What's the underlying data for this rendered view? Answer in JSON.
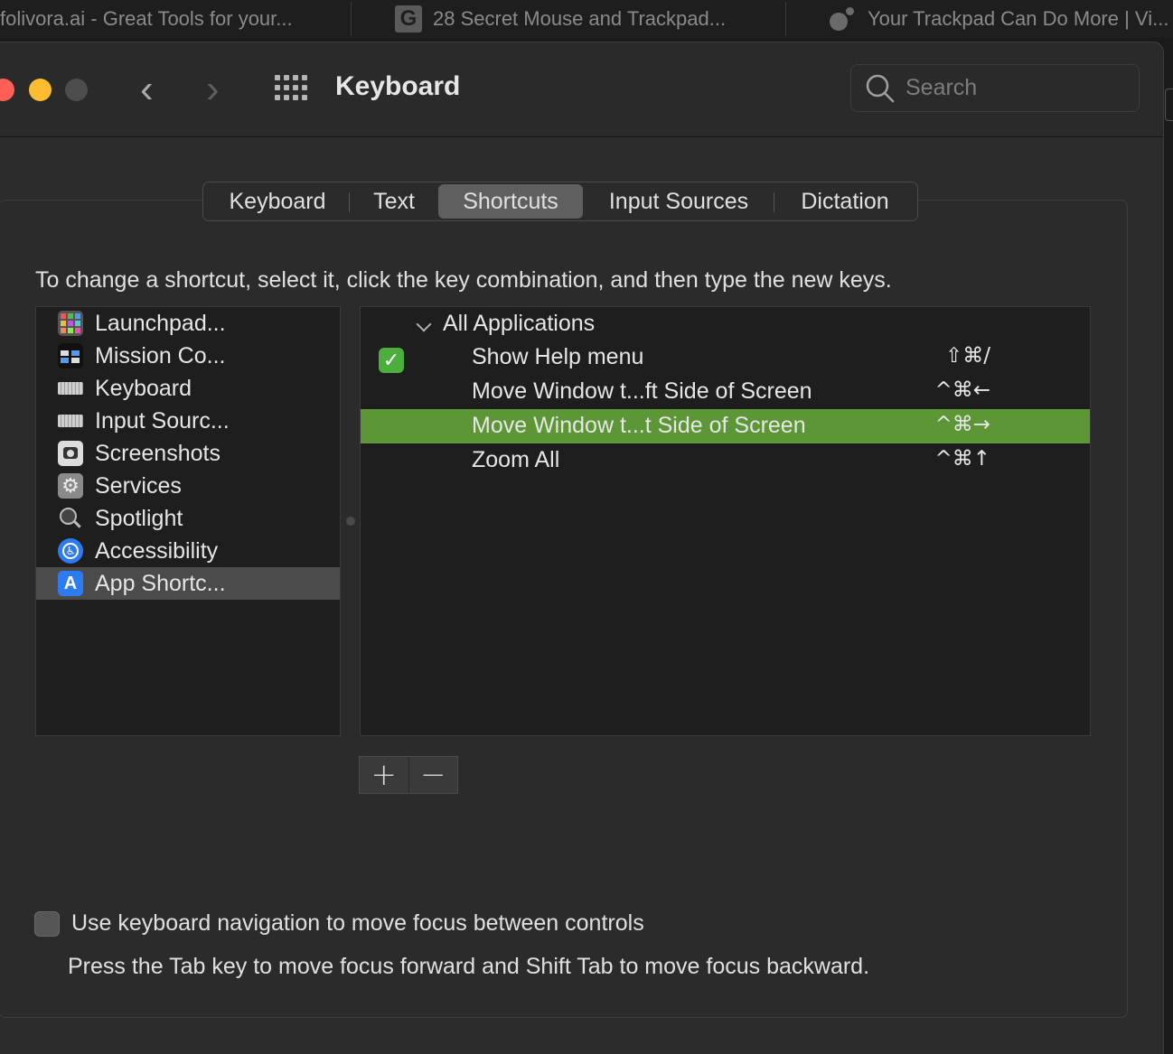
{
  "browser_tabs": [
    {
      "title": "folivora.ai - Great Tools for your..."
    },
    {
      "title": "28 Secret Mouse and Trackpad...",
      "icon": "G"
    },
    {
      "title": "Your Trackpad Can Do More | Vi..."
    }
  ],
  "window": {
    "title": "Keyboard",
    "search_placeholder": "Search",
    "traffic_lights": {
      "close": "#ff5f57",
      "minimize": "#febc2e",
      "zoom": "#4d4d4d"
    }
  },
  "tabs": [
    {
      "label": "Keyboard"
    },
    {
      "label": "Text"
    },
    {
      "label": "Shortcuts",
      "active": true
    },
    {
      "label": "Input Sources"
    },
    {
      "label": "Dictation"
    }
  ],
  "instruction": "To change a shortcut, select it, click the key combination, and then type the new keys.",
  "categories": [
    {
      "label": "Launchpad...",
      "icon": "launchpad-icon"
    },
    {
      "label": "Mission Co...",
      "icon": "mission-control-icon"
    },
    {
      "label": "Keyboard",
      "icon": "keyboard-icon"
    },
    {
      "label": "Input Sourc...",
      "icon": "input-sources-icon"
    },
    {
      "label": "Screenshots",
      "icon": "screenshot-icon"
    },
    {
      "label": "Services",
      "icon": "gear-icon"
    },
    {
      "label": "Spotlight",
      "icon": "magnifier-icon"
    },
    {
      "label": "Accessibility",
      "icon": "accessibility-icon"
    },
    {
      "label": "App Shortc...",
      "icon": "app-store-icon",
      "selected": true
    }
  ],
  "shortcuts": {
    "group": "All Applications",
    "items": [
      {
        "label": "Show Help menu",
        "keys": "⇧⌘/",
        "checked": true
      },
      {
        "label": "Move Window t...ft Side of Screen",
        "keys": "^⌘←"
      },
      {
        "label": "Move Window t...t Side of Screen",
        "keys": "^⌘→",
        "selected": true
      },
      {
        "label": "Zoom All",
        "keys": "^⌘↑"
      }
    ]
  },
  "buttons": {
    "add": "+",
    "remove": "−"
  },
  "keyboard_navigation": {
    "label": "Use keyboard navigation to move focus between controls",
    "checked": false,
    "description": "Press the Tab key to move focus forward and Shift Tab to move focus backward."
  },
  "colors": {
    "selection_green": "#5c9636",
    "checkbox_green": "#4caf3d"
  }
}
